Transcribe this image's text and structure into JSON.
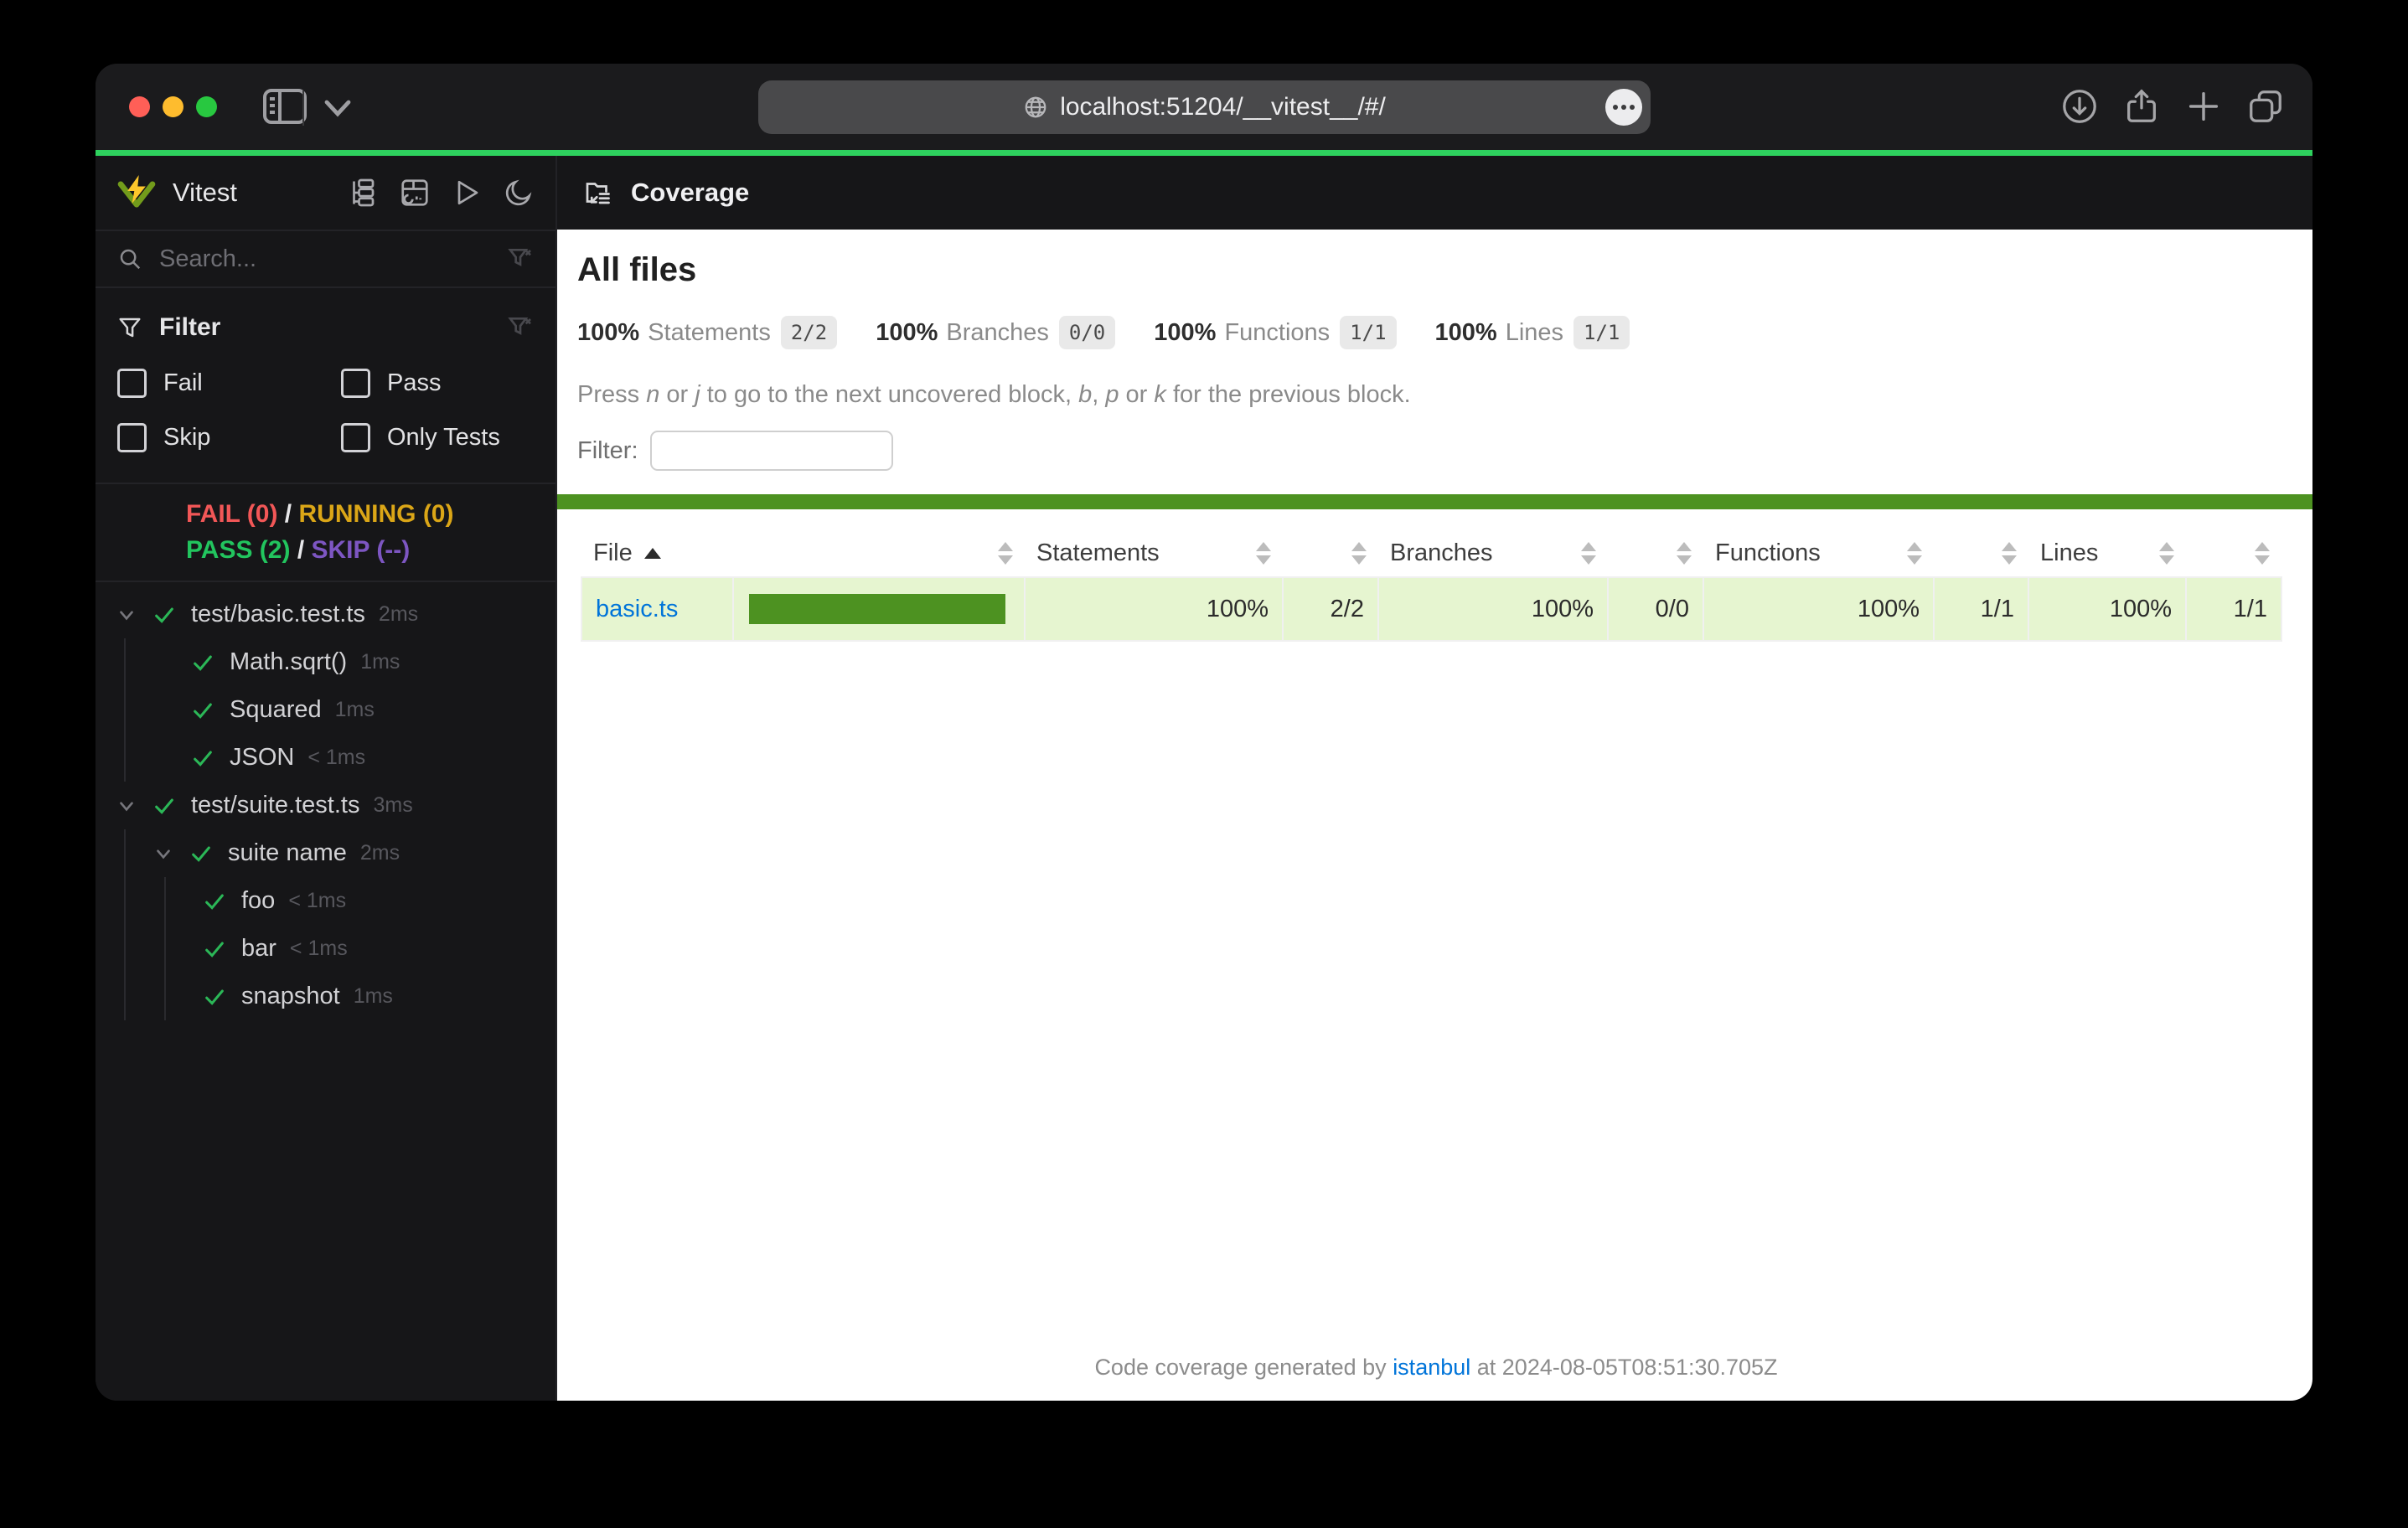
{
  "browser": {
    "url": "localhost:51204/__vitest__/#/"
  },
  "sidebar": {
    "app_name": "Vitest",
    "search_placeholder": "Search...",
    "filter": {
      "title": "Filter",
      "fail": "Fail",
      "pass": "Pass",
      "skip": "Skip",
      "only_tests": "Only Tests"
    },
    "status": {
      "fail": "FAIL (0)",
      "sep": "/",
      "running": "RUNNING (0)",
      "pass": "PASS (2)",
      "skip": "SKIP (--)"
    },
    "tree": [
      {
        "label": "test/basic.test.ts",
        "duration": "2ms"
      },
      {
        "label": "Math.sqrt()",
        "duration": "1ms"
      },
      {
        "label": "Squared",
        "duration": "1ms"
      },
      {
        "label": "JSON",
        "duration": "< 1ms"
      },
      {
        "label": "test/suite.test.ts",
        "duration": "3ms"
      },
      {
        "label": "suite name",
        "duration": "2ms"
      },
      {
        "label": "foo",
        "duration": "< 1ms"
      },
      {
        "label": "bar",
        "duration": "< 1ms"
      },
      {
        "label": "snapshot",
        "duration": "1ms"
      }
    ]
  },
  "coverage": {
    "header_title": "Coverage",
    "page_title": "All files",
    "stats": [
      {
        "pct": "100%",
        "label": "Statements",
        "frac": "2/2"
      },
      {
        "pct": "100%",
        "label": "Branches",
        "frac": "0/0"
      },
      {
        "pct": "100%",
        "label": "Functions",
        "frac": "1/1"
      },
      {
        "pct": "100%",
        "label": "Lines",
        "frac": "1/1"
      }
    ],
    "hint": {
      "p1": "Press ",
      "k1": "n",
      "p2": " or ",
      "k2": "j",
      "p3": " to go to the next uncovered block, ",
      "k3": "b",
      "p4": ", ",
      "k4": "p",
      "p5": " or ",
      "k5": "k",
      "p6": " for the previous block."
    },
    "filter_label": "Filter:",
    "table": {
      "col_file": "File",
      "col_statements": "Statements",
      "col_branches": "Branches",
      "col_functions": "Functions",
      "col_lines": "Lines",
      "row": {
        "file": "basic.ts",
        "statements_pct": "100%",
        "statements_frac": "2/2",
        "branches_pct": "100%",
        "branches_frac": "0/0",
        "functions_pct": "100%",
        "functions_frac": "1/1",
        "lines_pct": "100%",
        "lines_frac": "1/1"
      }
    },
    "footer": {
      "prefix": "Code coverage generated by ",
      "link": "istanbul",
      "suffix": " at 2024-08-05T08:51:30.705Z"
    }
  },
  "colors": {
    "accent_line": "#2ed15e",
    "coverage_green": "#4d9221",
    "coverage_row_bg": "#e6f5d0",
    "link_blue": "#0074d9",
    "fail_red": "#f25757",
    "running_yellow": "#dba617",
    "pass_green": "#22c55e",
    "skip_purple": "#7d56c2"
  }
}
